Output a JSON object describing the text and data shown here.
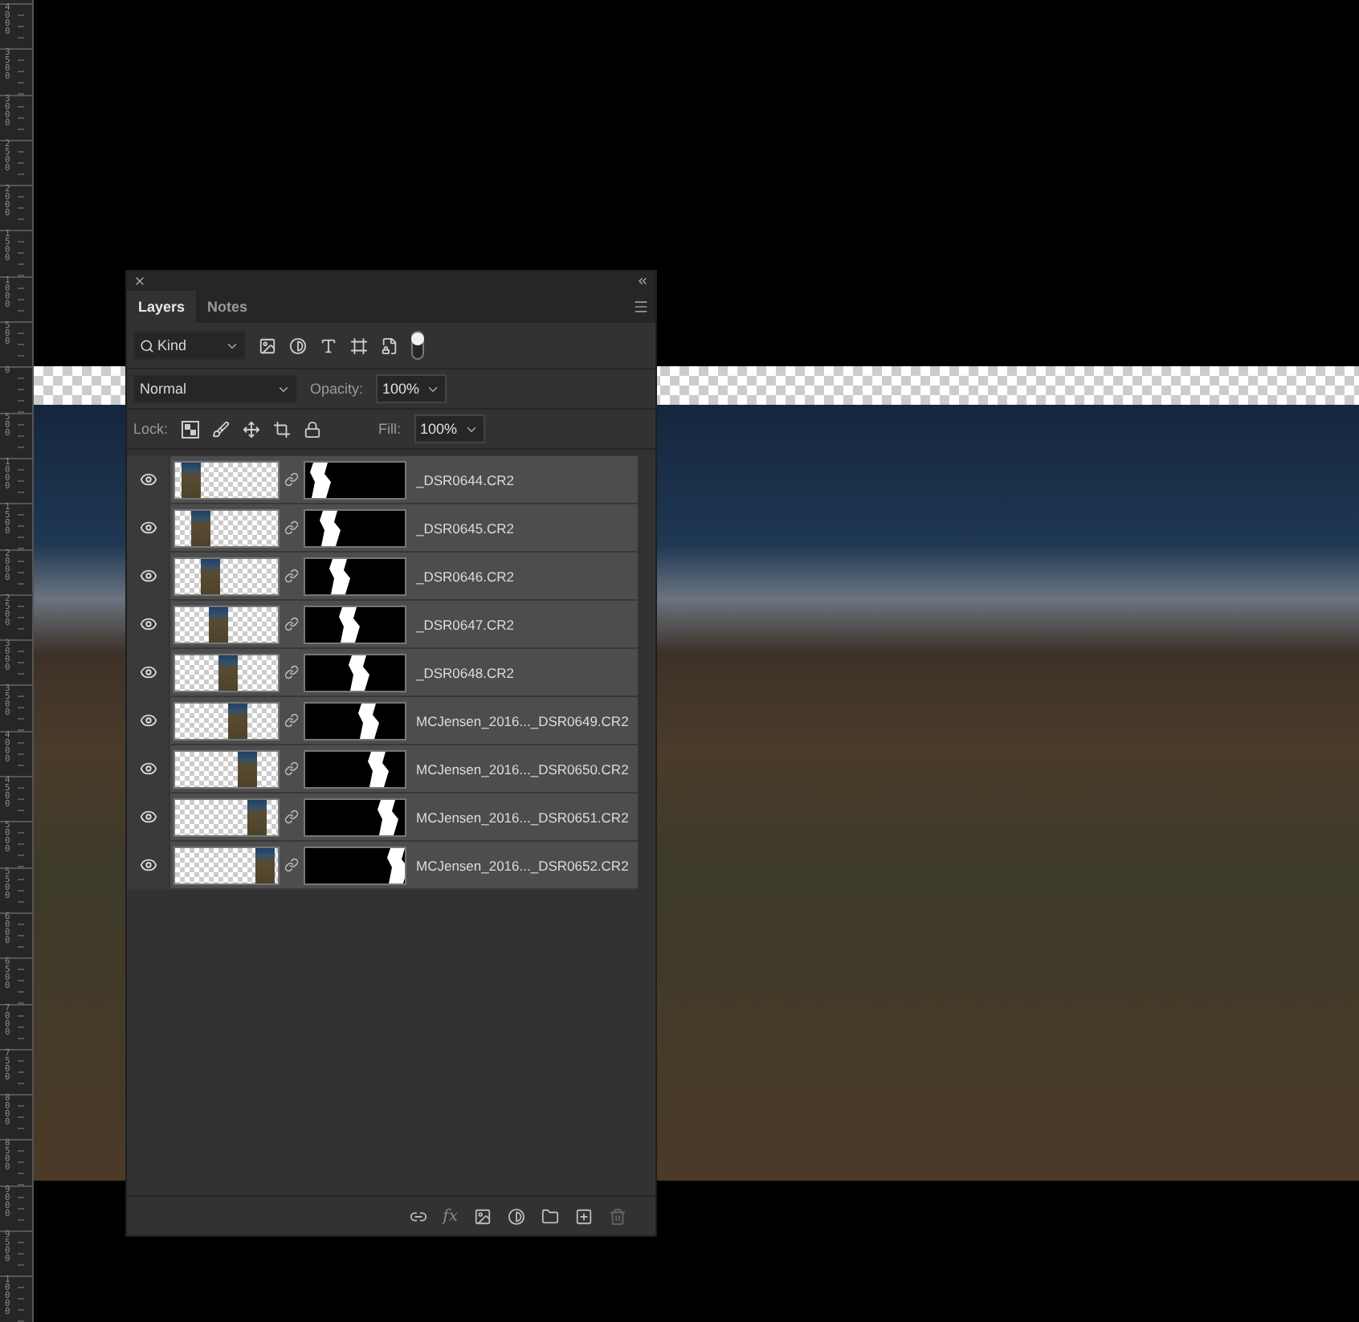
{
  "ruler": {
    "labels": [
      "4000",
      "3500",
      "3000",
      "2500",
      "2000",
      "1500",
      "1000",
      "500",
      "0",
      "500",
      "1000",
      "1500",
      "2000",
      "2500",
      "3000",
      "3500",
      "4000",
      "4500",
      "5000",
      "5500",
      "6000",
      "6500",
      "7000",
      "7500",
      "8000",
      "8500",
      "9000",
      "9500",
      "10000"
    ]
  },
  "layers_panel": {
    "tabs": [
      {
        "label": "Layers",
        "selected": true
      },
      {
        "label": "Notes",
        "selected": false
      }
    ],
    "filter": {
      "value": "Kind",
      "enabled": true
    },
    "blend_mode": "Normal",
    "opacity_label": "Opacity:",
    "opacity": "100%",
    "lock_label": "Lock:",
    "fill_label": "Fill:",
    "fill": "100%",
    "layers": [
      {
        "name": "_DSR0644.CR2",
        "visible": true
      },
      {
        "name": "_DSR0645.CR2",
        "visible": true
      },
      {
        "name": "_DSR0646.CR2",
        "visible": true
      },
      {
        "name": "_DSR0647.CR2",
        "visible": true
      },
      {
        "name": "_DSR0648.CR2",
        "visible": true
      },
      {
        "name": "MCJensen_2016..._DSR0649.CR2",
        "visible": true
      },
      {
        "name": "MCJensen_2016..._DSR0650.CR2",
        "visible": true
      },
      {
        "name": "MCJensen_2016..._DSR0651.CR2",
        "visible": true
      },
      {
        "name": "MCJensen_2016..._DSR0652.CR2",
        "visible": true
      }
    ],
    "footer": {
      "fx_label": "fx"
    }
  }
}
